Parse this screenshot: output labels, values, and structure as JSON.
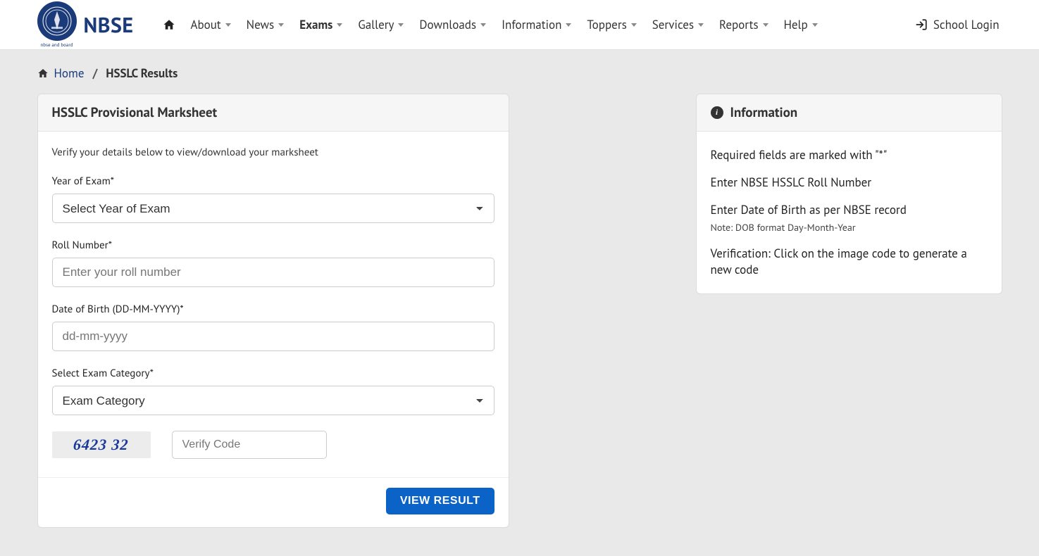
{
  "brand": {
    "name": "NBSE"
  },
  "nav": {
    "items": [
      {
        "label": "About"
      },
      {
        "label": "News"
      },
      {
        "label": "Exams",
        "active": true
      },
      {
        "label": "Gallery"
      },
      {
        "label": "Downloads"
      },
      {
        "label": "Information"
      },
      {
        "label": "Toppers"
      },
      {
        "label": "Services"
      },
      {
        "label": "Reports"
      },
      {
        "label": "Help"
      }
    ],
    "school_login": "School Login"
  },
  "breadcrumb": {
    "home": "Home",
    "current": "HSSLC Results"
  },
  "form": {
    "title": "HSSLC Provisional Marksheet",
    "intro": "Verify your details below to view/download your marksheet",
    "year_label": "Year of Exam",
    "year_placeholder": "Select Year of Exam",
    "roll_label": "Roll Number",
    "roll_placeholder": "Enter your roll number",
    "dob_label": "Date of Birth (DD-MM-YYYY)",
    "dob_placeholder": "dd-mm-yyyy",
    "cat_label": "Select Exam Category",
    "cat_placeholder": "Exam Category",
    "captcha_code": "6423 32",
    "captcha_placeholder": "Verify Code",
    "submit": "VIEW RESULT"
  },
  "info": {
    "title": "Information",
    "items": [
      {
        "text": "Required fields are marked with \"*\""
      },
      {
        "text": "Enter NBSE HSSLC Roll Number"
      },
      {
        "text": "Enter Date of Birth as per NBSE record",
        "note": "Note: DOB format Day-Month-Year"
      },
      {
        "text": "Verification: Click on the image code to generate a new code"
      }
    ]
  }
}
